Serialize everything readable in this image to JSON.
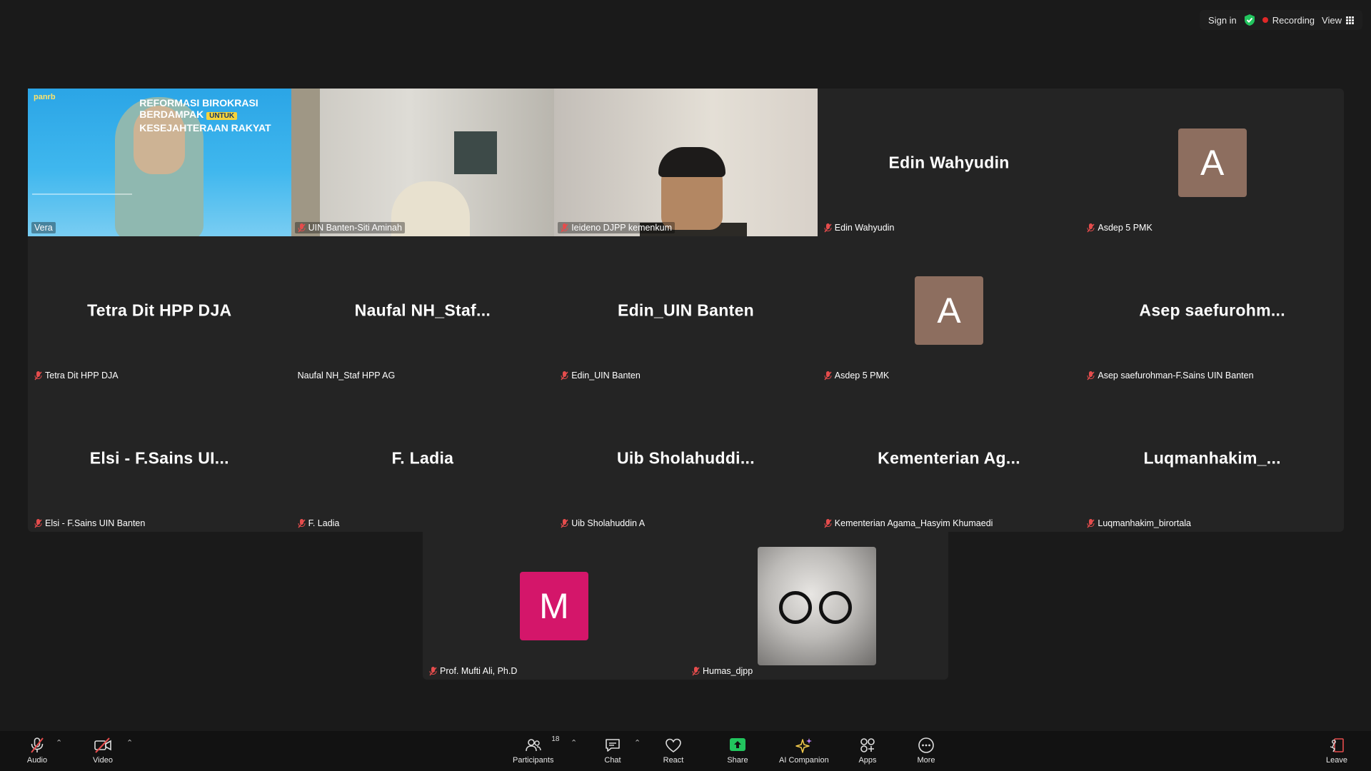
{
  "topbar": {
    "sign_in": "Sign in",
    "recording": "Recording",
    "view": "View"
  },
  "colors": {
    "active_speaker_outline": "#23d9a5",
    "avatar_brown": "#8d6e5f",
    "avatar_pink": "#d4166a",
    "recording_red": "#e02828",
    "mic_off_red": "#e54c4c"
  },
  "gallery": {
    "tiles": [
      {
        "type": "video",
        "label": "Vera",
        "muted": false,
        "active": true,
        "banner_line1": "REFORMASI BIROKRASI",
        "banner_line2": "BERDAMPAK",
        "banner_tag": "UNTUK",
        "banner_line3": "KESEJAHTERAAN RAKYAT",
        "logo": "panrb"
      },
      {
        "type": "video",
        "label": "UIN Banten-Siti Aminah",
        "muted": true
      },
      {
        "type": "video",
        "label": "Ieideno DJPP kemenkum",
        "muted": true
      },
      {
        "type": "name",
        "display": "Edin Wahyudin",
        "label": "Edin Wahyudin",
        "muted": true
      },
      {
        "type": "avatar",
        "initial": "A",
        "label": "Asdep 5 PMK",
        "muted": true
      },
      {
        "type": "name",
        "display": "Tetra Dit HPP DJA",
        "label": "Tetra Dit HPP DJA",
        "muted": true
      },
      {
        "type": "name",
        "display": "Naufal  NH_Staf...",
        "label": "Naufal NH_Staf HPP AG",
        "muted": false
      },
      {
        "type": "name",
        "display": "Edin_UIN Banten",
        "label": "Edin_UIN Banten",
        "muted": true
      },
      {
        "type": "avatar",
        "initial": "A",
        "label": "Asdep 5 PMK",
        "muted": true
      },
      {
        "type": "name",
        "display": "Asep  saefurohm...",
        "label": "Asep saefurohman-F.Sains UIN Banten",
        "muted": true
      },
      {
        "type": "name",
        "display": "Elsi  -  F.Sains  UI...",
        "label": "Elsi - F.Sains UIN Banten",
        "muted": true
      },
      {
        "type": "name",
        "display": "F.  Ladia",
        "label": "F. Ladia",
        "muted": true
      },
      {
        "type": "name",
        "display": "Uib  Sholahuddi...",
        "label": "Uib Sholahuddin A",
        "muted": true
      },
      {
        "type": "name",
        "display": "Kementerian  Ag...",
        "label": "Kementerian Agama_Hasyim Khumaedi",
        "muted": true
      },
      {
        "type": "name",
        "display": "Luqmanhakim_...",
        "label": "Luqmanhakim_birortala",
        "muted": true
      }
    ],
    "bottom_tiles": [
      {
        "type": "avatar",
        "initial": "M",
        "label": "Prof. Mufti Ali, Ph.D",
        "muted": true
      },
      {
        "type": "picture",
        "label": "Humas_djpp",
        "muted": true
      }
    ]
  },
  "toolbar": {
    "audio": "Audio",
    "video": "Video",
    "participants": "Participants",
    "participants_count": "18",
    "chat": "Chat",
    "react": "React",
    "share": "Share",
    "ai_companion": "AI Companion",
    "apps": "Apps",
    "more": "More",
    "leave": "Leave"
  }
}
